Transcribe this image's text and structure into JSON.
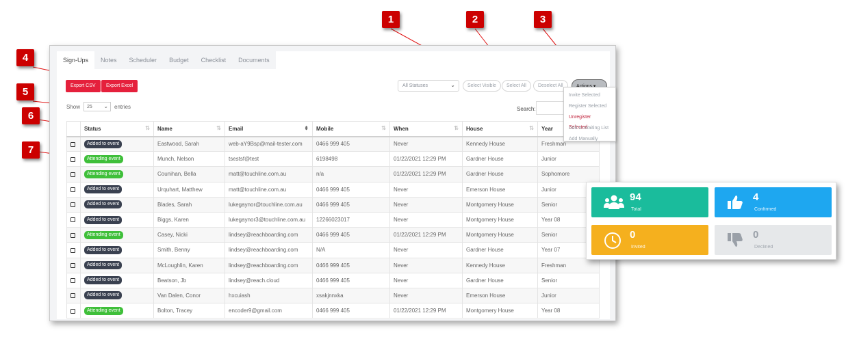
{
  "tabs": [
    "Sign-Ups",
    "Notes",
    "Scheduler",
    "Budget",
    "Checklist",
    "Documents"
  ],
  "export_csv": "Export CSV",
  "export_excel": "Export Excel",
  "show": {
    "prefix": "Show",
    "value": "25",
    "suffix": "entries"
  },
  "filter": {
    "value": "All Statuses"
  },
  "buttons": {
    "select_visible": "Select Visible",
    "select_all": "Select All",
    "deselect_all": "Deselect All",
    "actions": "Actions"
  },
  "search_label": "Search:",
  "table": {
    "headers": [
      "Status",
      "Name",
      "Email",
      "Mobile",
      "When",
      "House",
      "Year"
    ],
    "rows": [
      {
        "status": "Added to event",
        "type": "added",
        "name": "Eastwood, Sarah",
        "email": "web-aY9Bsp@mail-tester.com",
        "mobile": "0466 999 405",
        "when": "Never",
        "house": "Kennedy House",
        "year": "Freshman"
      },
      {
        "status": "Attending event",
        "type": "attending",
        "name": "Munch, Nelson",
        "email": "tsestsf@test",
        "mobile": "6198498",
        "when": "01/22/2021 12:29 PM",
        "house": "Gardner House",
        "year": "Junior"
      },
      {
        "status": "Attending event",
        "type": "attending",
        "name": "Counihan, Bella",
        "email": "matt@touchline.com.au",
        "mobile": "n/a",
        "when": "01/22/2021 12:29 PM",
        "house": "Gardner House",
        "year": "Sophomore"
      },
      {
        "status": "Added to event",
        "type": "added",
        "name": "Urquhart, Matthew",
        "email": "matt@touchline.com.au",
        "mobile": "0466 999 405",
        "when": "Never",
        "house": "Emerson House",
        "year": "Junior"
      },
      {
        "status": "Added to event",
        "type": "added",
        "name": "Blades, Sarah",
        "email": "lukegaynor@touchline.com.au",
        "mobile": "0466 999 405",
        "when": "Never",
        "house": "Montgomery House",
        "year": "Senior"
      },
      {
        "status": "Added to event",
        "type": "added",
        "name": "Biggs, Karen",
        "email": "lukegaynor3@touchline.com.au",
        "mobile": "12266023017",
        "when": "Never",
        "house": "Montgomery House",
        "year": "Year 08"
      },
      {
        "status": "Attending event",
        "type": "attending",
        "name": "Casey, Nicki",
        "email": "lindsey@reachboarding.com",
        "mobile": "0466 999 405",
        "when": "01/22/2021 12:29 PM",
        "house": "Montgomery House",
        "year": "Senior"
      },
      {
        "status": "Added to event",
        "type": "added",
        "name": "Smith, Benny",
        "email": "lindsey@reachboarding.com",
        "mobile": "N/A",
        "when": "Never",
        "house": "Gardner House",
        "year": "Year 07"
      },
      {
        "status": "Added to event",
        "type": "added",
        "name": "McLoughlin, Karen",
        "email": "lindsey@reachboarding.com",
        "mobile": "0466 999 405",
        "when": "Never",
        "house": "Kennedy House",
        "year": "Freshman"
      },
      {
        "status": "Added to event",
        "type": "added",
        "name": "Beatson, Jb",
        "email": "lindsey@reach.cloud",
        "mobile": "0466 999 405",
        "when": "Never",
        "house": "Gardner House",
        "year": "Senior"
      },
      {
        "status": "Added to event",
        "type": "added",
        "name": "Van Dalen, Conor",
        "email": "hxcuiash",
        "mobile": "xsakjnnxka",
        "when": "Never",
        "house": "Emerson House",
        "year": "Junior"
      },
      {
        "status": "Attending event",
        "type": "attending",
        "name": "Bolton, Tracey",
        "email": "encoder9@gmail.com",
        "mobile": "0466 999 405",
        "when": "01/22/2021 12:29 PM",
        "house": "Montgomery House",
        "year": "Year 08"
      }
    ]
  },
  "actions_menu": [
    "Invite Selected",
    "Register Selected",
    "Unregister Selected",
    "Add to Waiting List",
    "Add Manually"
  ],
  "stats": [
    {
      "value": "94",
      "label": "Total",
      "color": "#1abc9c",
      "icon": "users-icon"
    },
    {
      "value": "4",
      "label": "Confirmed",
      "color": "#1ea7f0",
      "icon": "thumbs-up-icon"
    },
    {
      "value": "0",
      "label": "Invited",
      "color": "#f5b01e",
      "icon": "clock-icon"
    },
    {
      "value": "0",
      "label": "Declined",
      "color": "#e6e8ea",
      "icon": "thumbs-down-icon"
    }
  ],
  "markers": [
    "1",
    "2",
    "3",
    "4",
    "5",
    "6",
    "7"
  ],
  "colors": {
    "accent_red": "#e5203c",
    "marker": "#cc0000",
    "added_badge": "#3a4150",
    "attending_badge": "#3fbf3a"
  }
}
